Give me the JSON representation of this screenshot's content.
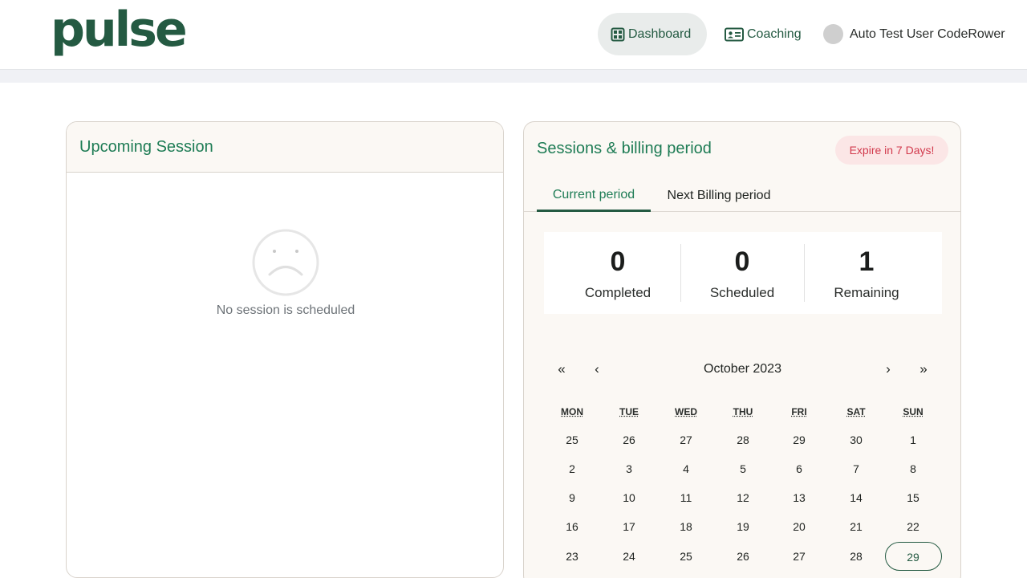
{
  "header": {
    "logo": "pulse",
    "nav": {
      "dashboard": "Dashboard",
      "coaching": "Coaching"
    },
    "user_name": "Auto Test User CodeRower"
  },
  "upcoming": {
    "title": "Upcoming Session",
    "empty_text": "No session is scheduled"
  },
  "billing": {
    "title": "Sessions & billing period",
    "badge": "Expire in 7 Days!",
    "tabs": [
      "Current period",
      "Next Billing period"
    ],
    "active_tab": "Current period",
    "stats": [
      {
        "value": "0",
        "label": "Completed"
      },
      {
        "value": "0",
        "label": "Scheduled"
      },
      {
        "value": "1",
        "label": "Remaining"
      }
    ]
  },
  "calendar": {
    "month_label": "October 2023",
    "nav": {
      "prev_year": "«",
      "prev_month": "‹",
      "next_month": "›",
      "next_year": "»"
    },
    "weekdays": [
      "MON",
      "TUE",
      "WED",
      "THU",
      "FRI",
      "SAT",
      "SUN"
    ],
    "weeks": [
      [
        "25",
        "26",
        "27",
        "28",
        "29",
        "30",
        "1"
      ],
      [
        "2",
        "3",
        "4",
        "5",
        "6",
        "7",
        "8"
      ],
      [
        "9",
        "10",
        "11",
        "12",
        "13",
        "14",
        "15"
      ],
      [
        "16",
        "17",
        "18",
        "19",
        "20",
        "21",
        "22"
      ],
      [
        "23",
        "24",
        "25",
        "26",
        "27",
        "28",
        "29"
      ]
    ],
    "today": "29"
  },
  "colors": {
    "brand": "#245a42",
    "accent_text": "#1e7c55",
    "badge_bg": "#fbe6e6",
    "badge_text": "#d23a4d"
  }
}
